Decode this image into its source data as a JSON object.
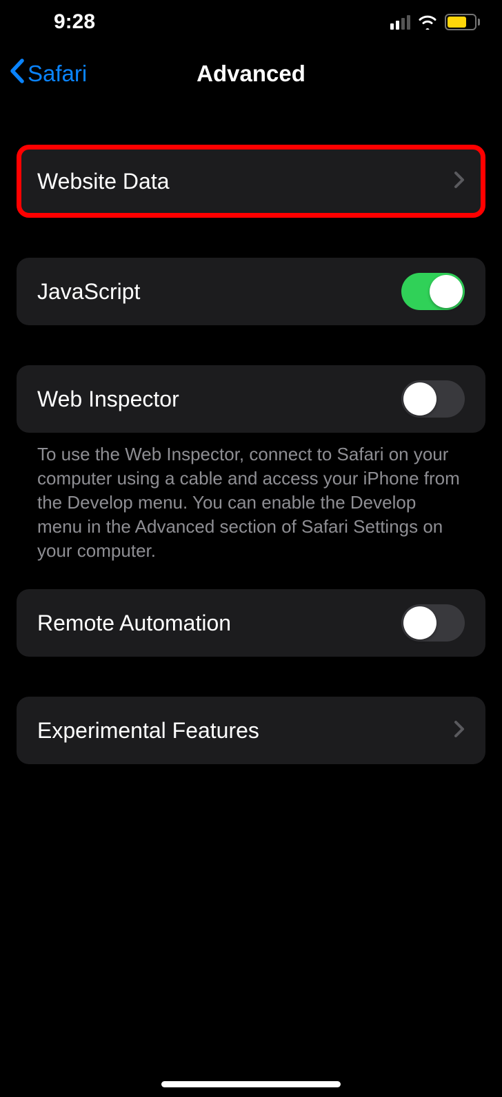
{
  "statusBar": {
    "time": "9:28"
  },
  "nav": {
    "backLabel": "Safari",
    "title": "Advanced"
  },
  "rows": {
    "websiteData": {
      "label": "Website Data"
    },
    "javascript": {
      "label": "JavaScript",
      "on": true
    },
    "webInspector": {
      "label": "Web Inspector",
      "on": false
    },
    "webInspectorFooter": "To use the Web Inspector, connect to Safari on your computer using a cable and access your iPhone from the Develop menu. You can enable the Develop menu in the Advanced section of Safari Settings on your computer.",
    "remoteAutomation": {
      "label": "Remote Automation",
      "on": false
    },
    "experimentalFeatures": {
      "label": "Experimental Features"
    }
  }
}
